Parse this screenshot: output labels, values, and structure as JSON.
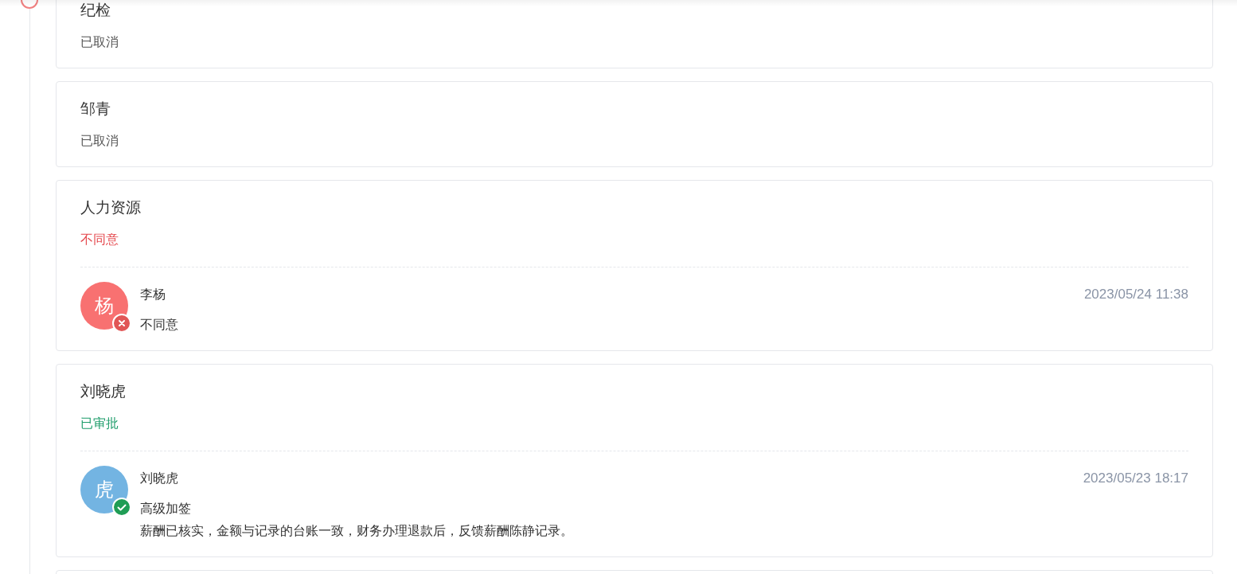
{
  "steps": [
    {
      "name": "纪检",
      "status": {
        "kind": "cancelled",
        "text": "已取消"
      }
    },
    {
      "name": "邹青",
      "status": {
        "kind": "cancelled",
        "text": "已取消"
      }
    },
    {
      "name": "人力资源",
      "status": {
        "kind": "rejected",
        "text": "不同意"
      },
      "approvals": [
        {
          "avatar": "杨",
          "color": "#f87171",
          "approved": false,
          "person": "李杨",
          "action": "不同意",
          "time": "2023/05/24 11:38"
        }
      ]
    },
    {
      "name": "刘晓虎",
      "status": {
        "kind": "approved",
        "text": "已审批"
      },
      "approvals": [
        {
          "avatar": "虎",
          "color": "#73b4e2",
          "approved": true,
          "person": "刘晓虎",
          "action": "高级加签",
          "comment": "薪酬已核实，金额与记录的台账一致，财务办理退款后，反馈薪酬陈静记录。",
          "time": "2023/05/23 18:17"
        }
      ]
    }
  ]
}
